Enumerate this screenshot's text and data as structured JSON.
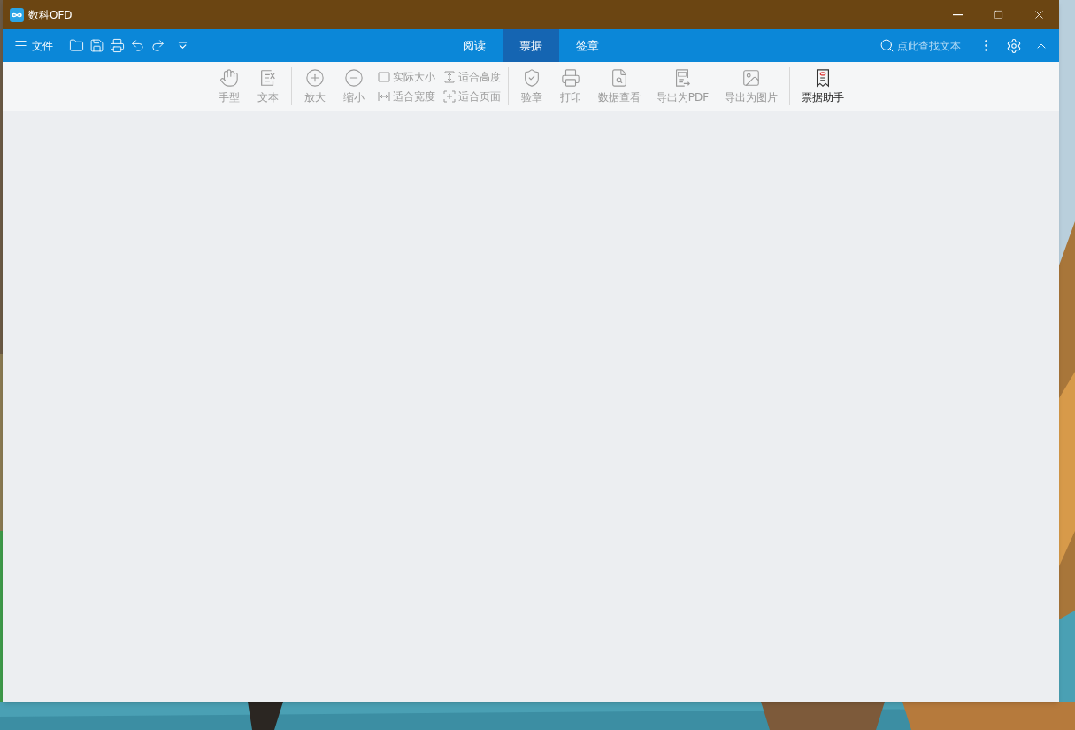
{
  "window": {
    "title": "数科OFD"
  },
  "menu": {
    "label": "文件"
  },
  "tabs": [
    {
      "label": "阅读",
      "selected": false
    },
    {
      "label": "票据",
      "selected": true
    },
    {
      "label": "签章",
      "selected": false
    }
  ],
  "search": {
    "placeholder": "点此查找文本"
  },
  "toolbar": [
    {
      "items": [
        {
          "kind": "large",
          "label": "手型",
          "disabled": true
        },
        {
          "kind": "large",
          "label": "文本",
          "disabled": true
        }
      ]
    },
    {
      "items": [
        {
          "kind": "large",
          "label": "放大",
          "disabled": true
        },
        {
          "kind": "large",
          "label": "缩小",
          "disabled": true
        },
        {
          "kind": "pair",
          "rows": [
            {
              "label": "实际大小",
              "disabled": true
            },
            {
              "label": "适合宽度",
              "disabled": true
            }
          ]
        },
        {
          "kind": "pair",
          "rows": [
            {
              "label": "适合高度",
              "disabled": true
            },
            {
              "label": "适合页面",
              "disabled": true
            }
          ]
        }
      ]
    },
    {
      "items": [
        {
          "kind": "large",
          "label": "验章",
          "disabled": true
        },
        {
          "kind": "large",
          "label": "打印",
          "disabled": true
        },
        {
          "kind": "large",
          "label": "数据查看",
          "disabled": true
        },
        {
          "kind": "large",
          "label": "导出为PDF",
          "disabled": true
        },
        {
          "kind": "large",
          "label": "导出为图片",
          "disabled": true
        }
      ]
    },
    {
      "items": [
        {
          "kind": "large",
          "label": "票据助手",
          "disabled": false
        }
      ]
    }
  ]
}
